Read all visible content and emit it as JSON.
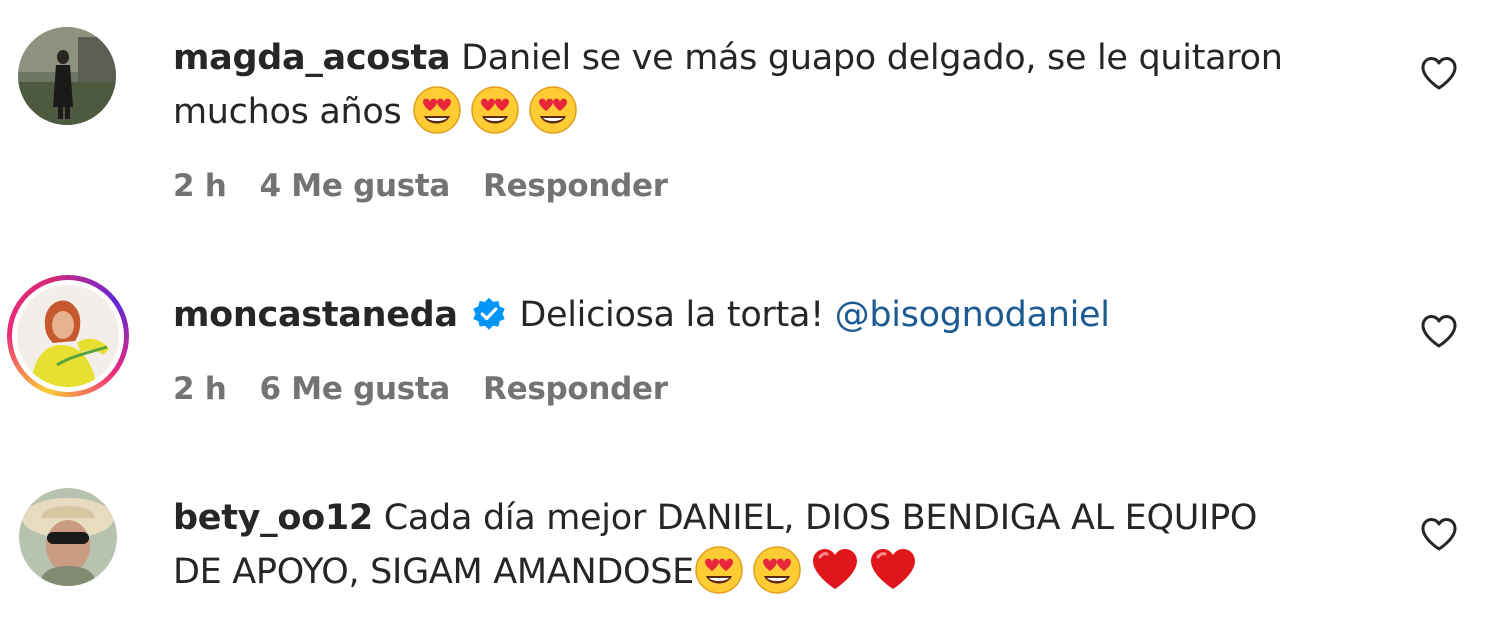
{
  "comments": [
    {
      "username": "magda_acosta",
      "text": "Daniel se ve más guapo delgado, se le quitaron muchos años",
      "text_line1": "Daniel se ve más guapo delgado, se le quitaron",
      "text_line2": "muchos años",
      "emojis": [
        "heart-eyes-emoji",
        "heart-eyes-emoji",
        "heart-eyes-emoji"
      ],
      "time": "2 h",
      "likes": "4 Me gusta",
      "reply": "Responder",
      "verified": false,
      "has_story_ring": false
    },
    {
      "username": "moncastaneda",
      "text": "Deliciosa la torta!",
      "mention": "@bisognodaniel",
      "time": "2 h",
      "likes": "6 Me gusta",
      "reply": "Responder",
      "verified": true,
      "has_story_ring": true
    },
    {
      "username": "bety_oo12",
      "text_line1": "Cada día mejor DANIEL, DIOS BENDIGA AL EQUIPO",
      "text_line2": "DE APOYO, SIGAM AMANDOSE",
      "emojis": [
        "heart-eyes-emoji",
        "heart-eyes-emoji",
        "red-heart-emoji",
        "red-heart-emoji"
      ],
      "verified": false,
      "has_story_ring": false
    }
  ],
  "icons": {
    "like": "heart-outline-icon",
    "verified": "verified-badge-icon"
  },
  "colors": {
    "text": "#262626",
    "meta": "#737373",
    "mention": "#1d5a91",
    "verified": "#0095f6"
  }
}
